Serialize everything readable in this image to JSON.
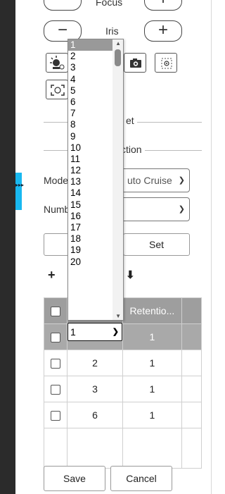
{
  "sidebar_toggle": {
    "glyph": "▸▸▸"
  },
  "focus": {
    "label": "Focus",
    "minus": "−",
    "plus": "+"
  },
  "iris": {
    "label": "Iris",
    "minus": "−",
    "plus": "+"
  },
  "icon_buttons": {
    "icons": [
      "backlight-icon",
      "camera-snapshot-icon",
      "focus-area-icon",
      "focus-frame-icon"
    ]
  },
  "preset_section": {
    "title": "et"
  },
  "function_section": {
    "title": "ction"
  },
  "mode": {
    "label": "Mode",
    "value": "uto Cruise"
  },
  "number": {
    "label": "Numb",
    "value": ""
  },
  "set_button": {
    "label": "Set"
  },
  "toolbar": {
    "add_icon": "+",
    "download_icon": "⬇"
  },
  "table": {
    "header_retention": "Retentio...",
    "selected_row": {
      "id": "1",
      "retention": "1"
    },
    "rows": [
      {
        "id": "2",
        "retention": "1"
      },
      {
        "id": "3",
        "retention": "1"
      },
      {
        "id": "6",
        "retention": "1"
      }
    ]
  },
  "dropdown": {
    "selected": "1",
    "options": [
      "1",
      "2",
      "3",
      "4",
      "5",
      "6",
      "7",
      "8",
      "9",
      "10",
      "11",
      "12",
      "13",
      "14",
      "15",
      "16",
      "17",
      "18",
      "19",
      "20"
    ]
  },
  "footer": {
    "save_label": "Save",
    "cancel_label": "Cancel"
  }
}
